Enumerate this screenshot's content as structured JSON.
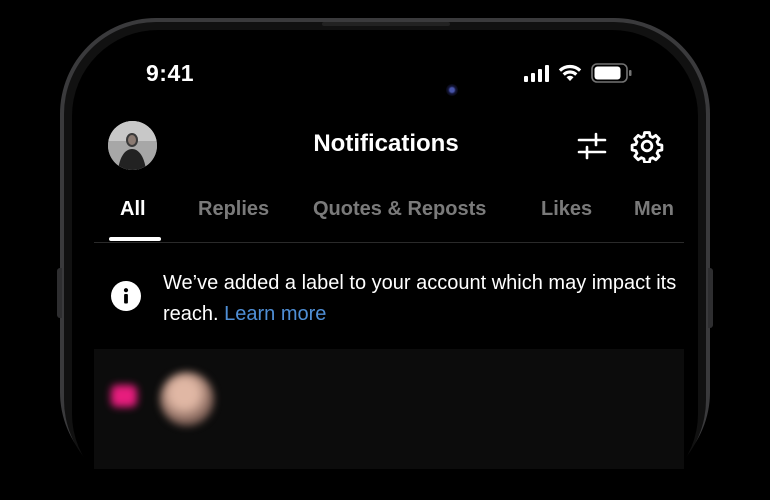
{
  "status_bar": {
    "time": "9:41",
    "signal_bars": 4,
    "battery_level_percent": 85
  },
  "header": {
    "title": "Notifications",
    "avatar_icon": "profile-avatar",
    "filter_icon": "sliders-icon",
    "settings_icon": "gear-icon"
  },
  "tabs": [
    {
      "label": "All",
      "active": true
    },
    {
      "label": "Replies",
      "active": false
    },
    {
      "label": "Quotes & Reposts",
      "active": false
    },
    {
      "label": "Likes",
      "active": false
    },
    {
      "label": "Men",
      "active": false
    }
  ],
  "notice": {
    "icon": "info-icon",
    "text": "We’ve added a label to your account which may impact its reach.",
    "link_text": "Learn more"
  },
  "colors": {
    "background": "#000000",
    "text_primary": "#ffffff",
    "text_inactive": "#7a7a7a",
    "link": "#4f8fd6",
    "like_accent": "#ff1f8a"
  }
}
